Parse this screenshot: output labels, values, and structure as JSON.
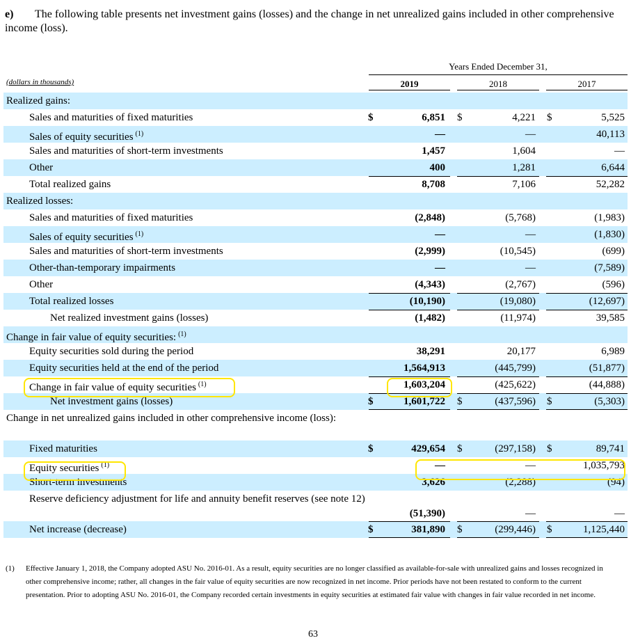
{
  "intro": {
    "label": "e)",
    "text": "The following table presents net investment gains (losses) and the change in net unrealized gains included in other comprehensive income (loss)."
  },
  "header": {
    "period": "Years Ended December 31,",
    "units": "(dollars in thousands)",
    "years": [
      "2019",
      "2018",
      "2017"
    ]
  },
  "sup_marker": "(1)",
  "currency": "$",
  "rows": [
    {
      "label": "Realized gains:",
      "indent": 0,
      "shade": true
    },
    {
      "label": "Sales and maturities of fixed maturities",
      "indent": 1,
      "dollar": true,
      "v": [
        "6,851",
        "4,221",
        "5,525"
      ]
    },
    {
      "label": "Sales of equity securities",
      "indent": 1,
      "sup": true,
      "shade": true,
      "v": [
        "—",
        "—",
        "40,113"
      ]
    },
    {
      "label": "Sales and maturities of short-term investments",
      "indent": 1,
      "v": [
        "1,457",
        "1,604",
        "—"
      ]
    },
    {
      "label": "Other",
      "indent": 1,
      "shade": true,
      "v": [
        "400",
        "1,281",
        "6,644"
      ]
    },
    {
      "label": "Total realized gains",
      "indent": 1,
      "ruleTop": true,
      "v": [
        "8,708",
        "7,106",
        "52,282"
      ]
    },
    {
      "label": "Realized losses:",
      "indent": 0,
      "shade": true
    },
    {
      "label": "Sales and maturities of fixed maturities",
      "indent": 1,
      "v": [
        "(2,848)",
        "(5,768)",
        "(1,983)"
      ]
    },
    {
      "label": "Sales of equity securities",
      "indent": 1,
      "sup": true,
      "shade": true,
      "v": [
        "—",
        "—",
        "(1,830)"
      ]
    },
    {
      "label": "Sales and maturities of short-term investments",
      "indent": 1,
      "v": [
        "(2,999)",
        "(10,545)",
        "(699)"
      ]
    },
    {
      "label": "Other-than-temporary impairments",
      "indent": 1,
      "shade": true,
      "v": [
        "—",
        "—",
        "(7,589)"
      ]
    },
    {
      "label": "Other",
      "indent": 1,
      "v": [
        "(4,343)",
        "(2,767)",
        "(596)"
      ]
    },
    {
      "label": "Total realized losses",
      "indent": 1,
      "shade": true,
      "ruleTop": true,
      "v": [
        "(10,190)",
        "(19,080)",
        "(12,697)"
      ]
    },
    {
      "label": "Net realized investment gains (losses)",
      "indent": 2,
      "ruleTop": true,
      "v": [
        "(1,482)",
        "(11,974)",
        "39,585"
      ]
    },
    {
      "label": "Change in fair value of equity securities:",
      "indent": 0,
      "sup": true,
      "shade": true
    },
    {
      "label": "Equity securities sold during the period",
      "indent": 1,
      "v": [
        "38,291",
        "20,177",
        "6,989"
      ]
    },
    {
      "label": "Equity securities held at the end of the period",
      "indent": 1,
      "shade": true,
      "v": [
        "1,564,913",
        "(445,799)",
        "(51,877)"
      ]
    },
    {
      "label": "Change in fair value of equity securities",
      "indent": 1,
      "sup": true,
      "ruleTop": true,
      "v": [
        "1,603,204",
        "(425,622)",
        "(44,888)"
      ]
    },
    {
      "label": "Net investment gains (losses)",
      "indent": 2,
      "shade": true,
      "dollar": true,
      "ruleTop": true,
      "ruleBot": true,
      "v": [
        "1,601,722",
        "(437,596)",
        "(5,303)"
      ]
    },
    {
      "label": "Change in net unrealized gains included in other comprehensive income (loss):",
      "indent": 0,
      "tall": true
    },
    {
      "label": "Fixed maturities",
      "indent": 1,
      "shade": true,
      "dollar": true,
      "v": [
        "429,654",
        "(297,158)",
        "89,741"
      ]
    },
    {
      "label": "Equity securities",
      "indent": 1,
      "sup": true,
      "v": [
        "—",
        "—",
        "1,035,793"
      ]
    },
    {
      "label": "Short-term investments",
      "indent": 1,
      "shade": true,
      "v": [
        "3,626",
        "(2,288)",
        "(94)"
      ]
    },
    {
      "label": "Reserve deficiency adjustment for life and annuity benefit reserves (see note 12)",
      "indent": 1,
      "tall": true,
      "v": [
        "(51,390)",
        "—",
        "—"
      ]
    },
    {
      "label": "Net increase (decrease)",
      "indent": 1,
      "shade": true,
      "dollar": true,
      "ruleTop": true,
      "ruleBot": true,
      "v": [
        "381,890",
        "(299,446)",
        "1,125,440"
      ]
    }
  ],
  "footnote": {
    "marker": "(1)",
    "text": "Effective January 1, 2018, the Company adopted ASU No. 2016-01. As a result, equity securities are no longer classified as available-for-sale with unrealized gains and losses recognized in other comprehensive income; rather, all changes in the fair value of equity securities are now recognized in net income. Prior periods have not been restated to conform to the current presentation. Prior to adopting ASU No. 2016-01, the Company recorded certain investments in equity securities at estimated fair value with changes in fair value recorded in net income."
  },
  "page_number": "63"
}
